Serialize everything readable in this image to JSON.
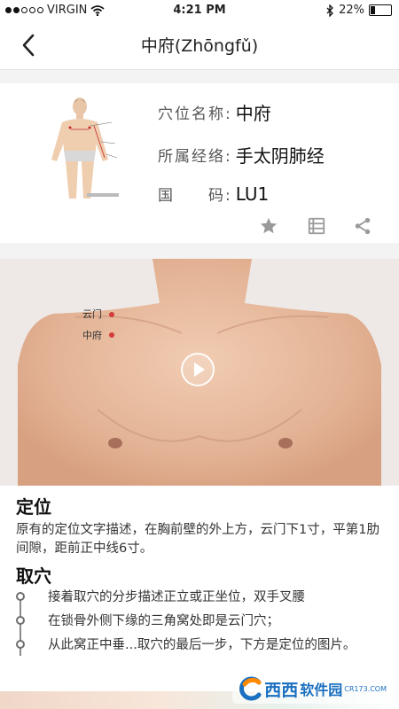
{
  "status_bar": {
    "carrier": "VIRGIN",
    "time": "4:21 PM",
    "battery": "22%",
    "battery_level": 0.22,
    "icons": [
      "signal-dots-icon",
      "wifi-icon",
      "bluetooth-icon",
      "battery-icon"
    ]
  },
  "nav": {
    "title": "中府(Zhōngfǔ)",
    "back_icon": "chevron-left-icon"
  },
  "acupoint": {
    "name_label": "穴位名称:",
    "name": "中府",
    "meridian_label": "所属经络:",
    "meridian": "手太阴肺经",
    "code_label": "国　　码:",
    "code": "LU1",
    "actions": [
      "star-icon",
      "list-icon",
      "share-icon"
    ]
  },
  "photo": {
    "points": [
      "云门",
      "中府"
    ],
    "play_icon": "play-icon"
  },
  "location": {
    "title": "定位",
    "text": "原有的定位文字描述，在胸前壁的外上方，云门下1寸，平第1肋间隙，距前正中线6寸。"
  },
  "method": {
    "title": "取穴",
    "steps": [
      "接着取穴的分步描述正立或正坐位，双手叉腰",
      "在锁骨外侧下缘的三角窝处即是云门穴；",
      "从此窝正中垂...取穴的最后一步，下方是定位的图片。"
    ]
  },
  "watermark": {
    "text": "西西",
    "sub": "CR173.COM",
    "suffix": "软件园"
  },
  "colors": {
    "accent_point": "#d33a3a",
    "icon_gray": "#9a9a9a",
    "watermark_blue": "#1a6fc0"
  }
}
